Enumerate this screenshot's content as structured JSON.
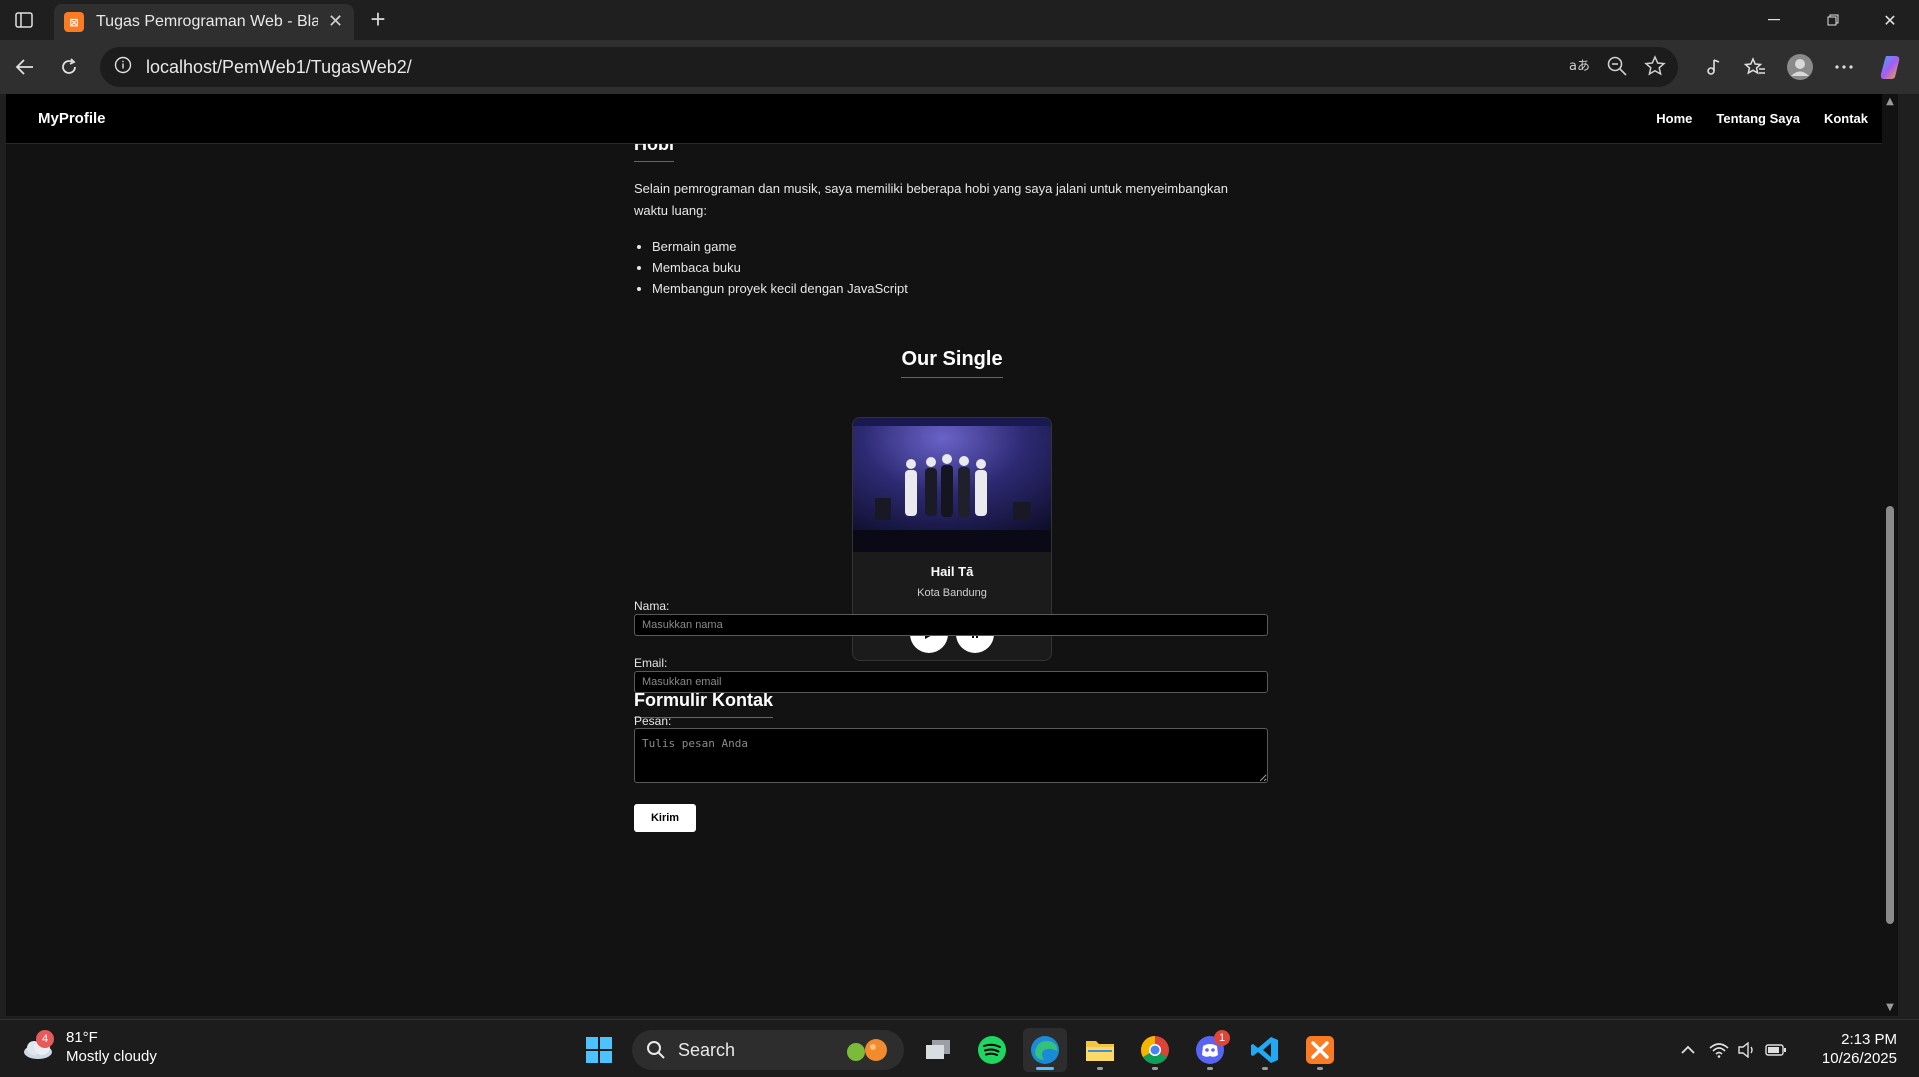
{
  "browser": {
    "tab_title": "Tugas Pemrograman Web - Black",
    "url": "localhost/PemWeb1/TugasWeb2/"
  },
  "site": {
    "brand": "MyProfile",
    "nav": [
      "Home",
      "Tentang Saya",
      "Kontak"
    ]
  },
  "hobi": {
    "title": "Hobi",
    "intro": "Selain pemrograman dan musik, saya memiliki beberapa hobi yang saya jalani untuk menyeimbangkan waktu luang:",
    "items": [
      "Bermain game",
      "Membaca buku",
      "Membangun proyek kecil dengan JavaScript"
    ]
  },
  "single": {
    "section_title": "Our Single",
    "song_title": "Hail Tā",
    "artist_location": "Kota Bandung",
    "play_icon": "play-icon",
    "pause_icon": "pause-icon"
  },
  "form": {
    "title": "Formulir Kontak",
    "name_label": "Nama:",
    "name_placeholder": "Masukkan nama",
    "email_label": "Email:",
    "email_placeholder": "Masukkan email",
    "message_label": "Pesan:",
    "message_placeholder": "Tulis pesan Anda",
    "submit_label": "Kirim"
  },
  "taskbar": {
    "weather_temp": "81°F",
    "weather_desc": "Mostly cloudy",
    "weather_badge": "4",
    "search_label": "Search",
    "discord_badge": "1",
    "time": "2:13 PM",
    "date": "10/26/2025"
  },
  "colors": {
    "accent_edge": "#4cc2ff",
    "xampp_orange": "#fb7a24",
    "page_bg": "#121212"
  }
}
